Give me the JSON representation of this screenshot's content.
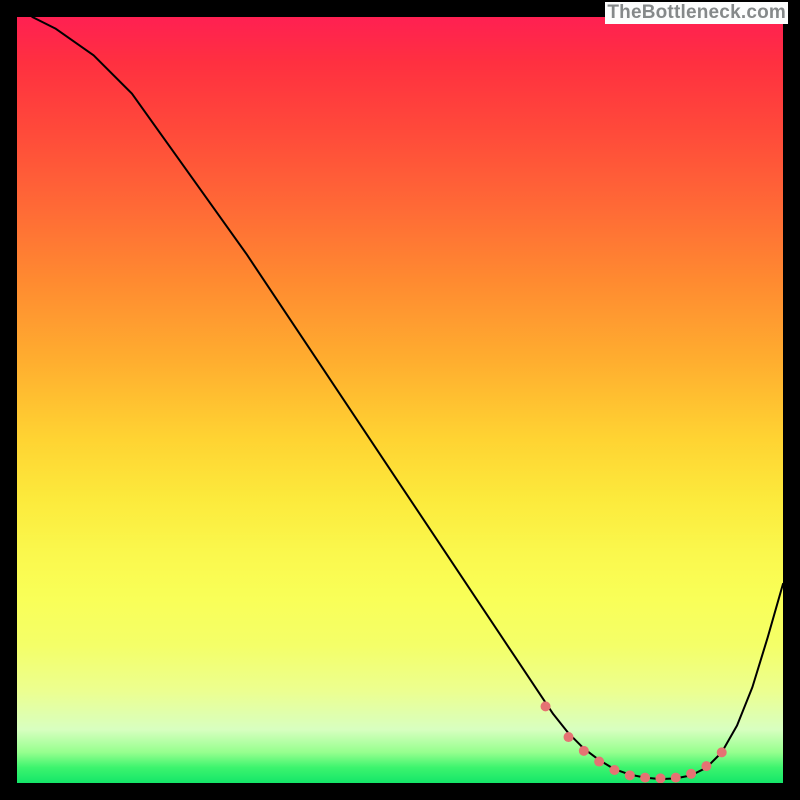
{
  "watermark": "TheBottleneck.com",
  "chart_data": {
    "type": "line",
    "title": "",
    "xlabel": "",
    "ylabel": "",
    "xlim": [
      0,
      100
    ],
    "ylim": [
      0,
      100
    ],
    "series": [
      {
        "name": "bottleneck-curve",
        "color": "#000000",
        "x": [
          2,
          5,
          10,
          15,
          20,
          25,
          30,
          35,
          40,
          45,
          50,
          55,
          60,
          65,
          68,
          70,
          72,
          74,
          76,
          78,
          80,
          82,
          84,
          86,
          88,
          90,
          92,
          94,
          96,
          98,
          100
        ],
        "y": [
          100,
          98.5,
          95,
          90,
          83,
          76,
          69,
          61.5,
          54,
          46.5,
          39,
          31.5,
          24,
          16.5,
          12,
          9,
          6.5,
          4.5,
          3.0,
          1.8,
          1.1,
          0.7,
          0.5,
          0.6,
          1.0,
          2.0,
          4.0,
          7.5,
          12.5,
          19,
          26
        ]
      }
    ],
    "markers": {
      "name": "optimal-range-dots",
      "color": "#e57373",
      "x": [
        69,
        72,
        74,
        76,
        78,
        80,
        82,
        84,
        86,
        88,
        90,
        92
      ],
      "y": [
        10.0,
        6.0,
        4.2,
        2.8,
        1.7,
        1.0,
        0.7,
        0.6,
        0.7,
        1.2,
        2.2,
        4.0
      ]
    }
  }
}
